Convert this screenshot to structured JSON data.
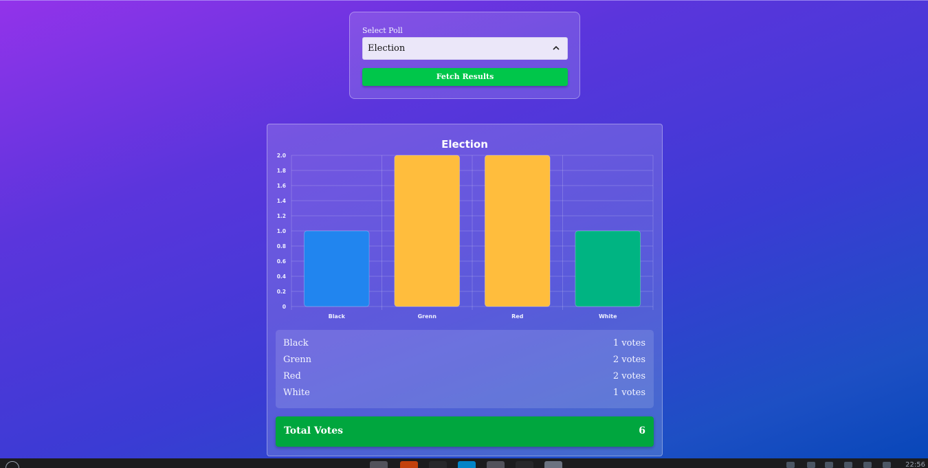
{
  "poll_selector": {
    "label": "Select Poll",
    "selected": "Election",
    "button_label": "Fetch Results"
  },
  "results": {
    "title": "Election",
    "items": [
      {
        "name": "Black",
        "votes": "1 votes"
      },
      {
        "name": "Grenn",
        "votes": "2 votes"
      },
      {
        "name": "Red",
        "votes": "2 votes"
      },
      {
        "name": "White",
        "votes": "1 votes"
      }
    ],
    "total_label": "Total Votes",
    "total_value": "6"
  },
  "chart_data": {
    "type": "bar",
    "title": "Election",
    "categories": [
      "Black",
      "Grenn",
      "Red",
      "White"
    ],
    "values": [
      1,
      2,
      2,
      1
    ],
    "colors": [
      "#2185ef",
      "#ffbd3d",
      "#ffbd3d",
      "#00b482"
    ],
    "ylim": [
      0,
      2
    ],
    "yticks": [
      "0",
      "0.2",
      "0.4",
      "0.6",
      "0.8",
      "1.0",
      "1.2",
      "1.4",
      "1.6",
      "1.8",
      "2.0"
    ],
    "grid": true,
    "xlabel": "",
    "ylabel": ""
  },
  "taskbar": {
    "clock": "22:56"
  }
}
